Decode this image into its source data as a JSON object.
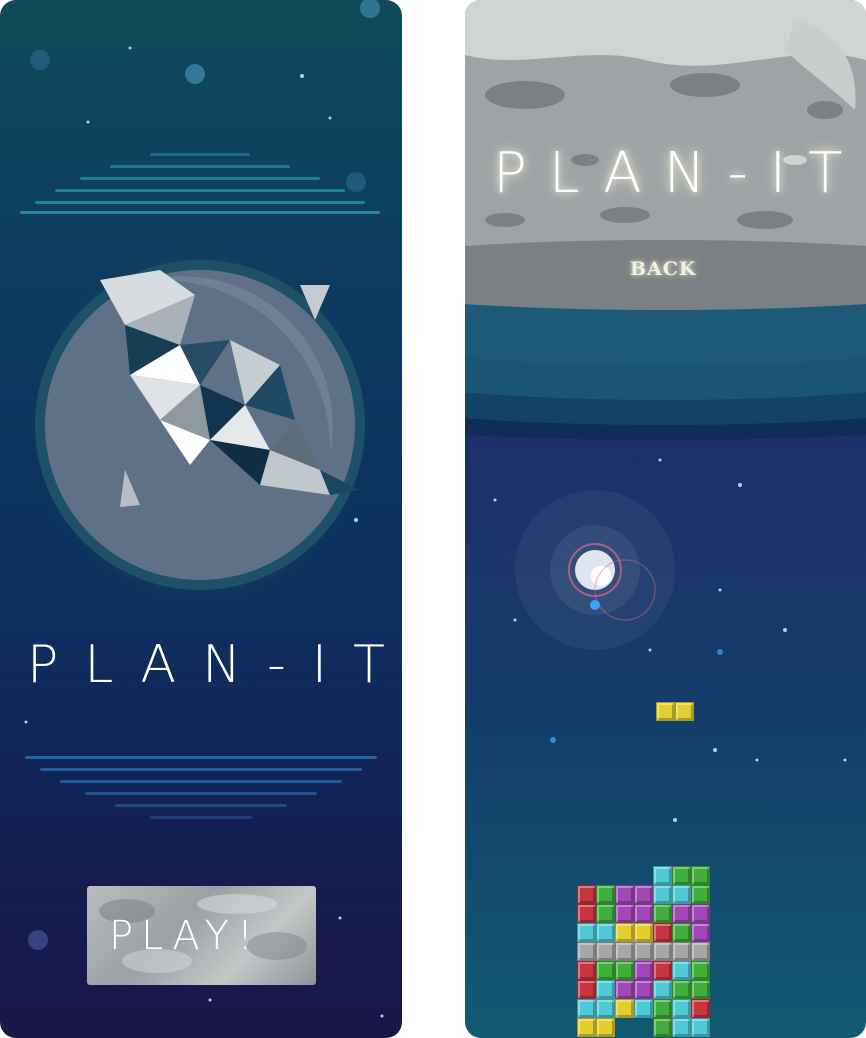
{
  "left_screen": {
    "title": "PLAN-IT",
    "play_label": "PLAY!"
  },
  "right_screen": {
    "title": "PLAN-IT",
    "back_label": "BACK"
  },
  "colors": {
    "background_top": "#0e4a5a",
    "background_bottom": "#1a1648",
    "planet": "#5e7186",
    "planet_ring": "#1d5168",
    "moon_surface": "#9ea3a6",
    "moon_band": "#1d5a78",
    "yellow": "#e2cf2e",
    "green": "#3fae3a",
    "purple": "#a147b8",
    "cyan": "#4fc9d6",
    "red": "#c8353f",
    "gray": "#a6a7a8"
  },
  "game": {
    "falling_piece_color": "yellow",
    "stack_rows": [
      [
        "",
        "",
        "",
        "",
        "cyan",
        "green",
        "green",
        "",
        "",
        ""
      ],
      [
        "red",
        "green",
        "purple",
        "purple",
        "cyan",
        "cyan",
        "green",
        "",
        "",
        ""
      ],
      [
        "red",
        "green",
        "purple",
        "purple",
        "green",
        "purple",
        "purple",
        "",
        "",
        ""
      ],
      [
        "cyan",
        "cyan",
        "yellow",
        "yellow",
        "red",
        "green",
        "purple",
        "",
        "",
        ""
      ],
      [
        "gray",
        "gray",
        "gray",
        "gray",
        "gray",
        "gray",
        "gray",
        "",
        "",
        ""
      ],
      [
        "red",
        "green",
        "green",
        "purple",
        "red",
        "cyan",
        "green",
        "",
        "",
        ""
      ],
      [
        "red",
        "cyan",
        "purple",
        "purple",
        "cyan",
        "green",
        "green",
        "",
        "",
        ""
      ],
      [
        "cyan",
        "cyan",
        "yellow",
        "cyan",
        "green",
        "cyan",
        "red",
        "",
        "",
        ""
      ],
      [
        "yellow",
        "yellow",
        "",
        "",
        "green",
        "cyan",
        "cyan",
        "",
        "",
        ""
      ]
    ]
  }
}
